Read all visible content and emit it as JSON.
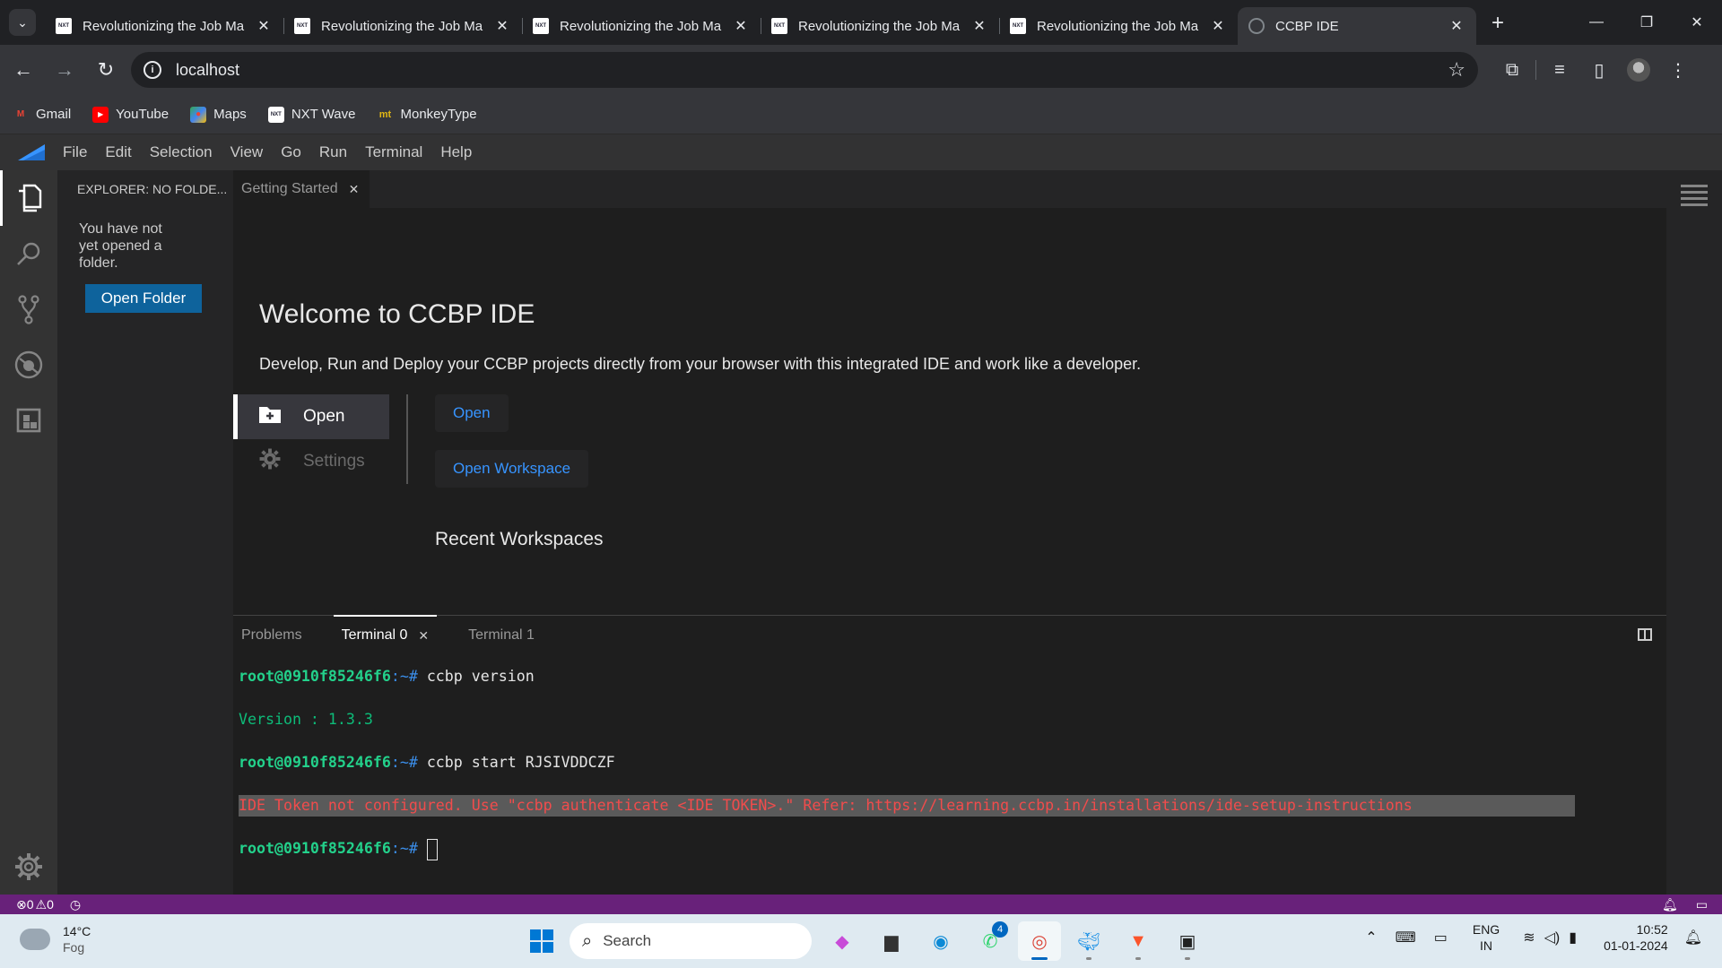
{
  "browser": {
    "tabs": [
      {
        "title": "Revolutionizing the Job Ma",
        "favicon": "nxt-wave-icon",
        "active": false
      },
      {
        "title": "Revolutionizing the Job Ma",
        "favicon": "nxt-wave-icon",
        "active": false
      },
      {
        "title": "Revolutionizing the Job Ma",
        "favicon": "nxt-wave-icon",
        "active": false
      },
      {
        "title": "Revolutionizing the Job Ma",
        "favicon": "nxt-wave-icon",
        "active": false
      },
      {
        "title": "Revolutionizing the Job Ma",
        "favicon": "nxt-wave-icon",
        "active": false
      },
      {
        "title": "CCBP IDE",
        "favicon": "globe-icon",
        "active": true
      }
    ],
    "address": "localhost",
    "bookmarks": [
      {
        "label": "Gmail",
        "icon": "gmail-icon",
        "color": "#ea4335"
      },
      {
        "label": "YouTube",
        "icon": "youtube-icon",
        "color": "#ff0000"
      },
      {
        "label": "Maps",
        "icon": "maps-icon",
        "color": "#34a853"
      },
      {
        "label": "NXT Wave",
        "icon": "nxt-wave-icon",
        "color": "#ffffff"
      },
      {
        "label": "MonkeyType",
        "icon": "monkeytype-icon",
        "color": "#e2b714"
      }
    ]
  },
  "ide": {
    "menu": [
      "File",
      "Edit",
      "Selection",
      "View",
      "Go",
      "Run",
      "Terminal",
      "Help"
    ],
    "explorer": {
      "title": "EXPLORER: NO FOLDE...",
      "message": "You have not yet opened a folder.",
      "button": "Open Folder"
    },
    "editor_tab": "Getting Started",
    "welcome": {
      "title": "Welcome to CCBP IDE",
      "subtitle": "Develop, Run and Deploy your CCBP projects directly from your browser with this integrated IDE and work like a developer.",
      "tab_open": "Open",
      "tab_settings": "Settings",
      "btn_open": "Open",
      "btn_open_workspace": "Open Workspace",
      "recent": "Recent Workspaces"
    },
    "panel": {
      "tabs": [
        "Problems",
        "Terminal 0",
        "Terminal 1"
      ],
      "prompt_user": "root@0910f85246f6",
      "prompt_sep": ":~# ",
      "cmd1": "ccbp version",
      "version_out": "Version : 1.3.3",
      "cmd2": "ccbp start RJSIVDDCZF",
      "error": "IDE Token not configured. Use \"ccbp authenticate <IDE TOKEN>.\" Refer: https://learning.ccbp.in/installations/ide-setup-instructions"
    },
    "status": {
      "errors": "0",
      "warnings": "0",
      "color": "#68217a"
    }
  },
  "taskbar": {
    "weather_temp": "14°C",
    "weather_desc": "Fog",
    "search_placeholder": "Search",
    "whatsapp_badge": "4",
    "lang_1": "ENG",
    "lang_2": "IN",
    "time": "10:52",
    "date": "01-01-2024"
  }
}
